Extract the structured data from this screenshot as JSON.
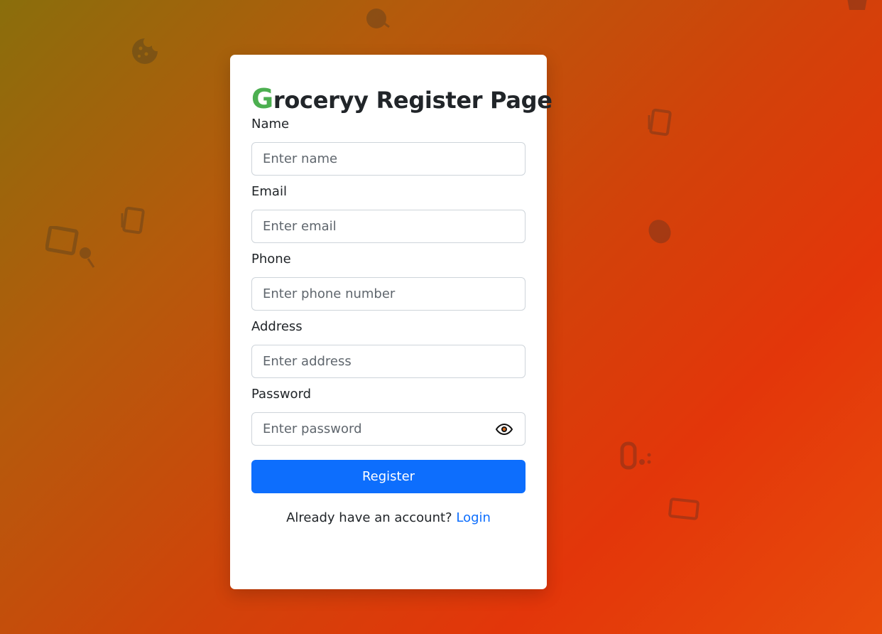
{
  "title": {
    "first_letter": "G",
    "rest": "roceryy Register Page",
    "accent_color": "#4caf50"
  },
  "form": {
    "name": {
      "label": "Name",
      "placeholder": "Enter name"
    },
    "email": {
      "label": "Email",
      "placeholder": "Enter email"
    },
    "phone": {
      "label": "Phone",
      "placeholder": "Enter phone number"
    },
    "address": {
      "label": "Address",
      "placeholder": "Enter address"
    },
    "password": {
      "label": "Password",
      "placeholder": "Enter password",
      "toggle_icon": "eye-icon"
    },
    "submit_label": "Register",
    "submit_color": "#0d6efd"
  },
  "footer": {
    "prompt": "Already have an account?",
    "link_label": "Login"
  },
  "background_icons": [
    "cookie-icon",
    "fruit-icon",
    "grocery-bag-icon",
    "fridge-icon",
    "leaf-icon",
    "milk-icon",
    "lemon-icon",
    "chili-icon",
    "utensils-icon"
  ]
}
